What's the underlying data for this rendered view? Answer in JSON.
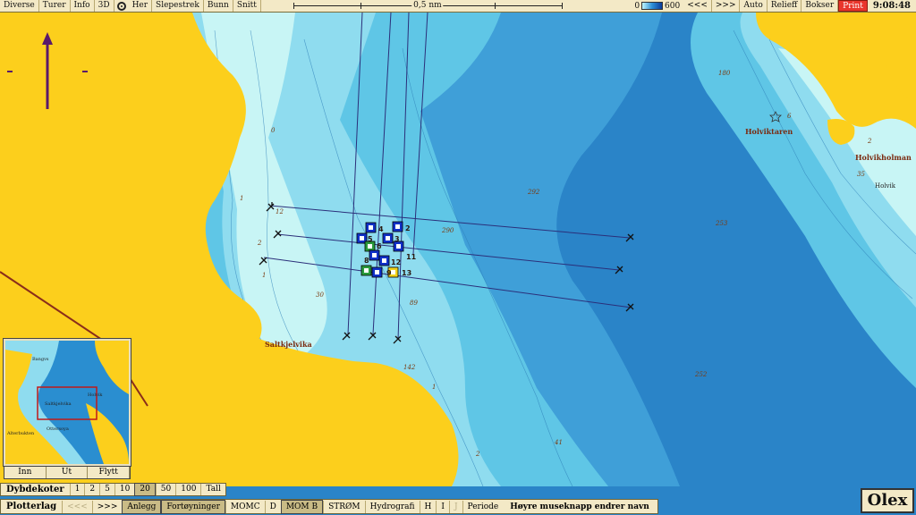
{
  "topbar": {
    "menu": [
      "Diverse",
      "Turer",
      "Info",
      "3D",
      "Her",
      "Slepestrek",
      "Bunn",
      "Snitt"
    ],
    "scale_label": "0,5 nm",
    "depth_min": "0",
    "depth_max": "600",
    "nav_prev": "<<<",
    "nav_next": ">>>",
    "buttons": [
      "Auto",
      "Relieff",
      "Bokser"
    ],
    "print": "Print",
    "clock": "9:08:48"
  },
  "map": {
    "places": {
      "saltkjelvika": "Saltkjelvika",
      "holviktaren": "Holviktaren",
      "holvikholman": "Holvikholman",
      "holvik": "Holvik"
    },
    "depths": [
      "180",
      "6",
      "2",
      "35",
      "292",
      "253",
      "290",
      "12",
      "2",
      "1",
      "30",
      "89",
      "142",
      "252",
      "41",
      "2",
      "1",
      "0",
      "1"
    ],
    "markers": [
      "4",
      "2",
      "5",
      "3",
      "6",
      "8",
      "11",
      "12",
      "9",
      "13"
    ],
    "colors": {
      "land": "#fccf1c",
      "shallow": "#c8f5f5",
      "mid": "#5fc6e6",
      "deep": "#2a84c8",
      "track": "#2b2f7a",
      "marker": "#1030c8"
    }
  },
  "minimap": {
    "labels": [
      "Bangvs",
      "Holvik",
      "Saltkjelvika",
      "Ottersoya",
      "Alterbukten"
    ],
    "nav": [
      "Inn",
      "Ut",
      "Flytt"
    ]
  },
  "depthbar": {
    "title": "Dybdekoter",
    "options": [
      "1",
      "2",
      "5",
      "10",
      "20",
      "50",
      "100",
      "Tall"
    ],
    "active": "20"
  },
  "plotbar": {
    "title": "Plotterlag",
    "prev": "<<<",
    "next": ">>>",
    "layers": [
      "Anlegg",
      "Fortøyninger",
      "MOMC",
      "D",
      "MOM B",
      "STRØM",
      "Hydrografi",
      "H",
      "I",
      "J",
      "Periode"
    ],
    "message": "Høyre museknapp endrer navn"
  },
  "brand": "Olex"
}
